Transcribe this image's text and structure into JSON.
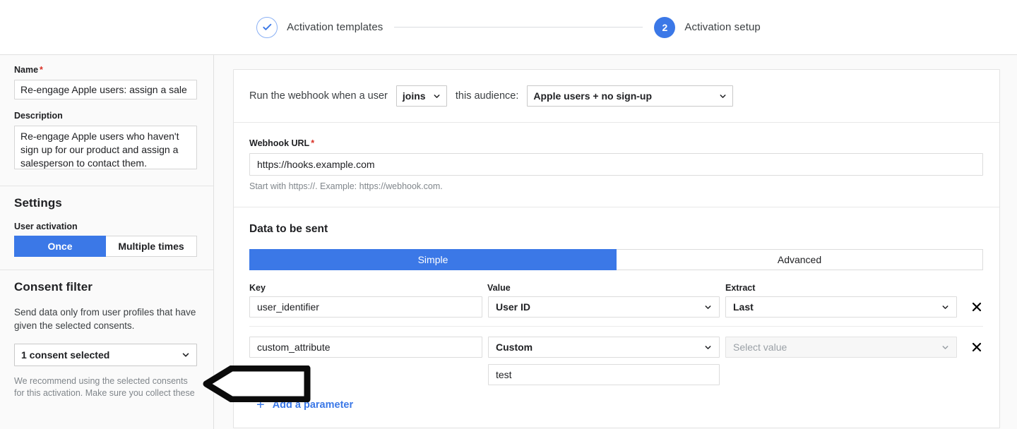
{
  "stepper": {
    "steps": [
      {
        "label": "Activation templates",
        "state": "done",
        "icon": "check-icon"
      },
      {
        "label": "Activation setup",
        "state": "active",
        "number": "2"
      }
    ]
  },
  "sidebar": {
    "name": {
      "label": "Name",
      "required_mark": "*",
      "value": "Re-engage Apple users: assign a sale"
    },
    "description": {
      "label": "Description",
      "value": "Re-engage Apple users who haven't sign up for our product and assign a salesperson to contact them."
    },
    "settings": {
      "heading": "Settings",
      "user_activation_label": "User activation",
      "options": [
        {
          "label": "Once",
          "selected": true
        },
        {
          "label": "Multiple times",
          "selected": false
        }
      ]
    },
    "consent_filter": {
      "heading": "Consent filter",
      "description": "Send data only from user profiles that have given the selected consents.",
      "select_value": "1 consent selected",
      "note": "We recommend using the selected consents for this activation. Make sure you collect these"
    }
  },
  "main": {
    "trigger": {
      "prefix": "Run the webhook when a user",
      "event_value": "joins",
      "middle": "this audience:",
      "audience_value": "Apple users + no sign-up"
    },
    "webhook_url": {
      "label": "Webhook URL",
      "required_mark": "*",
      "value": "https://hooks.example.com",
      "hint": "Start with https://. Example: https://webhook.com."
    },
    "data_to_be_sent": {
      "title": "Data to be sent",
      "tabs": [
        {
          "label": "Simple",
          "selected": true
        },
        {
          "label": "Advanced",
          "selected": false
        }
      ],
      "columns": {
        "key": "Key",
        "value": "Value",
        "extract": "Extract"
      },
      "rows": [
        {
          "key": "user_identifier",
          "value": "User ID",
          "extract": "Last",
          "extract_disabled": false,
          "remove_label": "✖"
        },
        {
          "key": "custom_attribute",
          "value": "Custom",
          "custom_value": "test",
          "extract": "Select value",
          "extract_disabled": true,
          "remove_label": "✖"
        }
      ],
      "add_parameter_label": "Add a parameter"
    }
  },
  "colors": {
    "accent": "#3b78e7",
    "required": "#d93025",
    "annotation": "#000000"
  }
}
